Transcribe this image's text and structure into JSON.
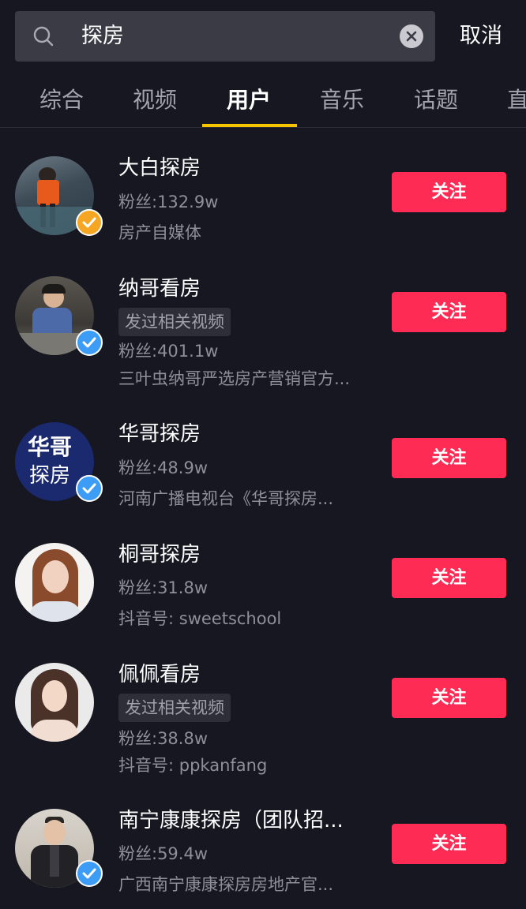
{
  "search": {
    "query": "探房",
    "cancel_label": "取消"
  },
  "tabs": [
    {
      "label": "综合"
    },
    {
      "label": "视频"
    },
    {
      "label": "用户"
    },
    {
      "label": "音乐"
    },
    {
      "label": "话题"
    },
    {
      "label": "直"
    }
  ],
  "active_tab": "用户",
  "colors": {
    "background": "#161721",
    "follow": "#fe2c55",
    "tab_indicator": "#f7c400",
    "verified_blue": "#3d9cf5",
    "verified_gold": "#f5a623"
  },
  "users": [
    {
      "name": "大白探房",
      "fans": "粉丝:132.9w",
      "desc": "房产自媒体",
      "follow_label": "关注",
      "verified": "gold-check-icon"
    },
    {
      "name": "纳哥看房",
      "tag": "发过相关视频",
      "fans": "粉丝:401.1w",
      "desc": "三叶虫纳哥严选房产营销官方...",
      "follow_label": "关注",
      "verified": "blue-check-icon"
    },
    {
      "name": "华哥探房",
      "fans": "粉丝:48.9w",
      "desc": "河南广播电视台《华哥探房...",
      "follow_label": "关注",
      "verified": "blue-check-icon",
      "avatar_text1": "华哥",
      "avatar_text2": "探房"
    },
    {
      "name": "桐哥探房",
      "fans": "粉丝:31.8w",
      "desc": "抖音号: sweetschool",
      "follow_label": "关注"
    },
    {
      "name": "佩佩看房",
      "tag": "发过相关视频",
      "fans": "粉丝:38.8w",
      "desc": "抖音号: ppkanfang",
      "follow_label": "关注"
    },
    {
      "name": "南宁康康探房（团队招...",
      "fans": "粉丝:59.4w",
      "desc": "广西南宁康康探房房地产官...",
      "follow_label": "关注",
      "verified": "blue-check-icon"
    }
  ]
}
